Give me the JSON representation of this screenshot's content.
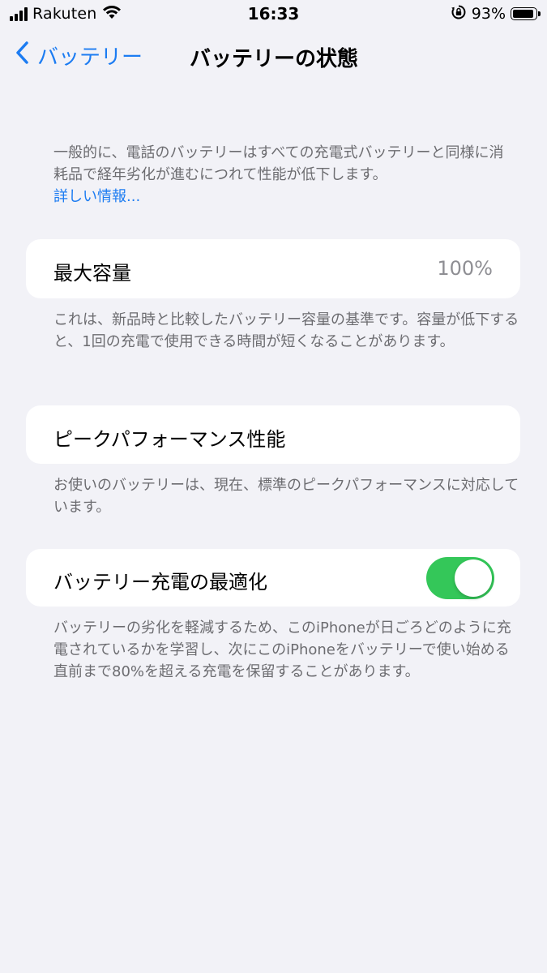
{
  "status_bar": {
    "carrier": "Rakuten",
    "time": "16:33",
    "battery_percent": "93%",
    "icons": [
      "signal-icon",
      "wifi-icon",
      "orientation-lock-icon",
      "battery-icon"
    ]
  },
  "nav": {
    "back_label": "バッテリー",
    "title": "バッテリーの状態"
  },
  "intro": {
    "text": "一般的に、電話のバッテリーはすべての充電式バッテリーと同様に消耗品で経年劣化が進むにつれて性能が低下します。",
    "link": "詳しい情報..."
  },
  "max_capacity": {
    "label": "最大容量",
    "value": "100%",
    "footnote": "これは、新品時と比較したバッテリー容量の基準です。容量が低下すると、1回の充電で使用できる時間が短くなることがあります。"
  },
  "peak_performance": {
    "label": "ピークパフォーマンス性能",
    "footnote": "お使いのバッテリーは、現在、標準のピークパフォーマンスに対応しています。"
  },
  "optimized_charging": {
    "label": "バッテリー充電の最適化",
    "enabled": true,
    "footnote": "バッテリーの劣化を軽減するため、このiPhoneが日ごろどのように充電されているかを学習し、次にこのiPhoneをバッテリーで使い始める直前まで80%を超える充電を保留することがあります。"
  },
  "colors": {
    "background": "#f2f2f7",
    "accent": "#1c7cf2",
    "toggle_on": "#34c759",
    "secondary_text": "#6c6c70"
  }
}
